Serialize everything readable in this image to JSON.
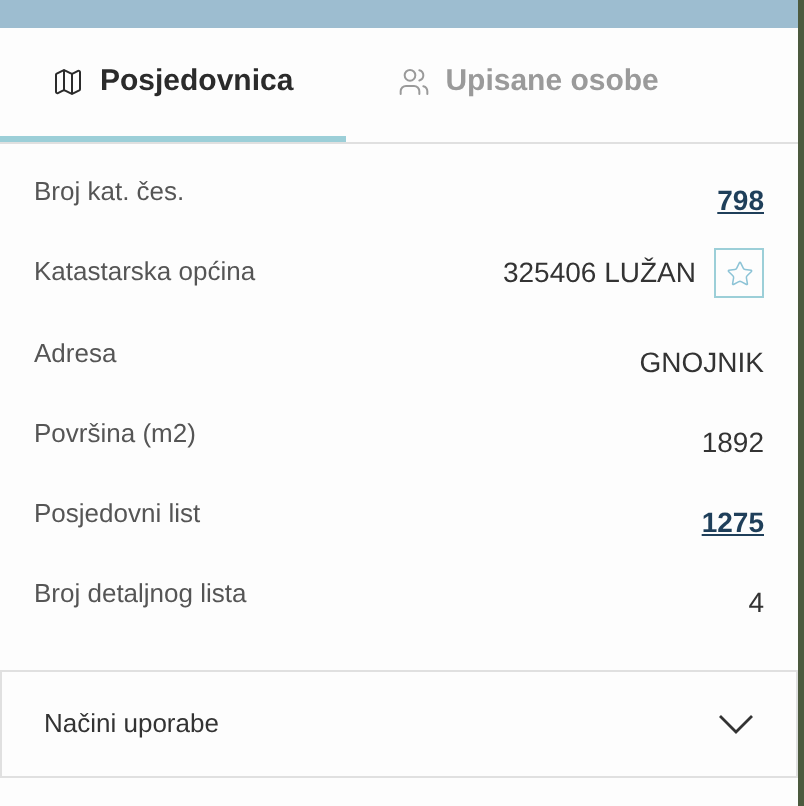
{
  "tabs": [
    {
      "label": "Posjedovnica",
      "selected": true
    },
    {
      "label": "Upisane osobe",
      "selected": false
    }
  ],
  "rows": [
    {
      "label": "Broj kat. čes.",
      "value": "798",
      "kind": "link"
    },
    {
      "label": "Katastarska općina",
      "value": "325406 LUŽAN",
      "kind": "starred"
    },
    {
      "label": "Adresa",
      "value": "GNOJNIK",
      "kind": "text"
    },
    {
      "label": "Površina (m2)",
      "value": "1892",
      "kind": "text"
    },
    {
      "label": "Posjedovni list",
      "value": "1275",
      "kind": "link"
    },
    {
      "label": "Broj detaljnog lista",
      "value": "4",
      "kind": "text"
    }
  ],
  "accordion": {
    "title": "Načini uporabe",
    "expanded": false
  }
}
